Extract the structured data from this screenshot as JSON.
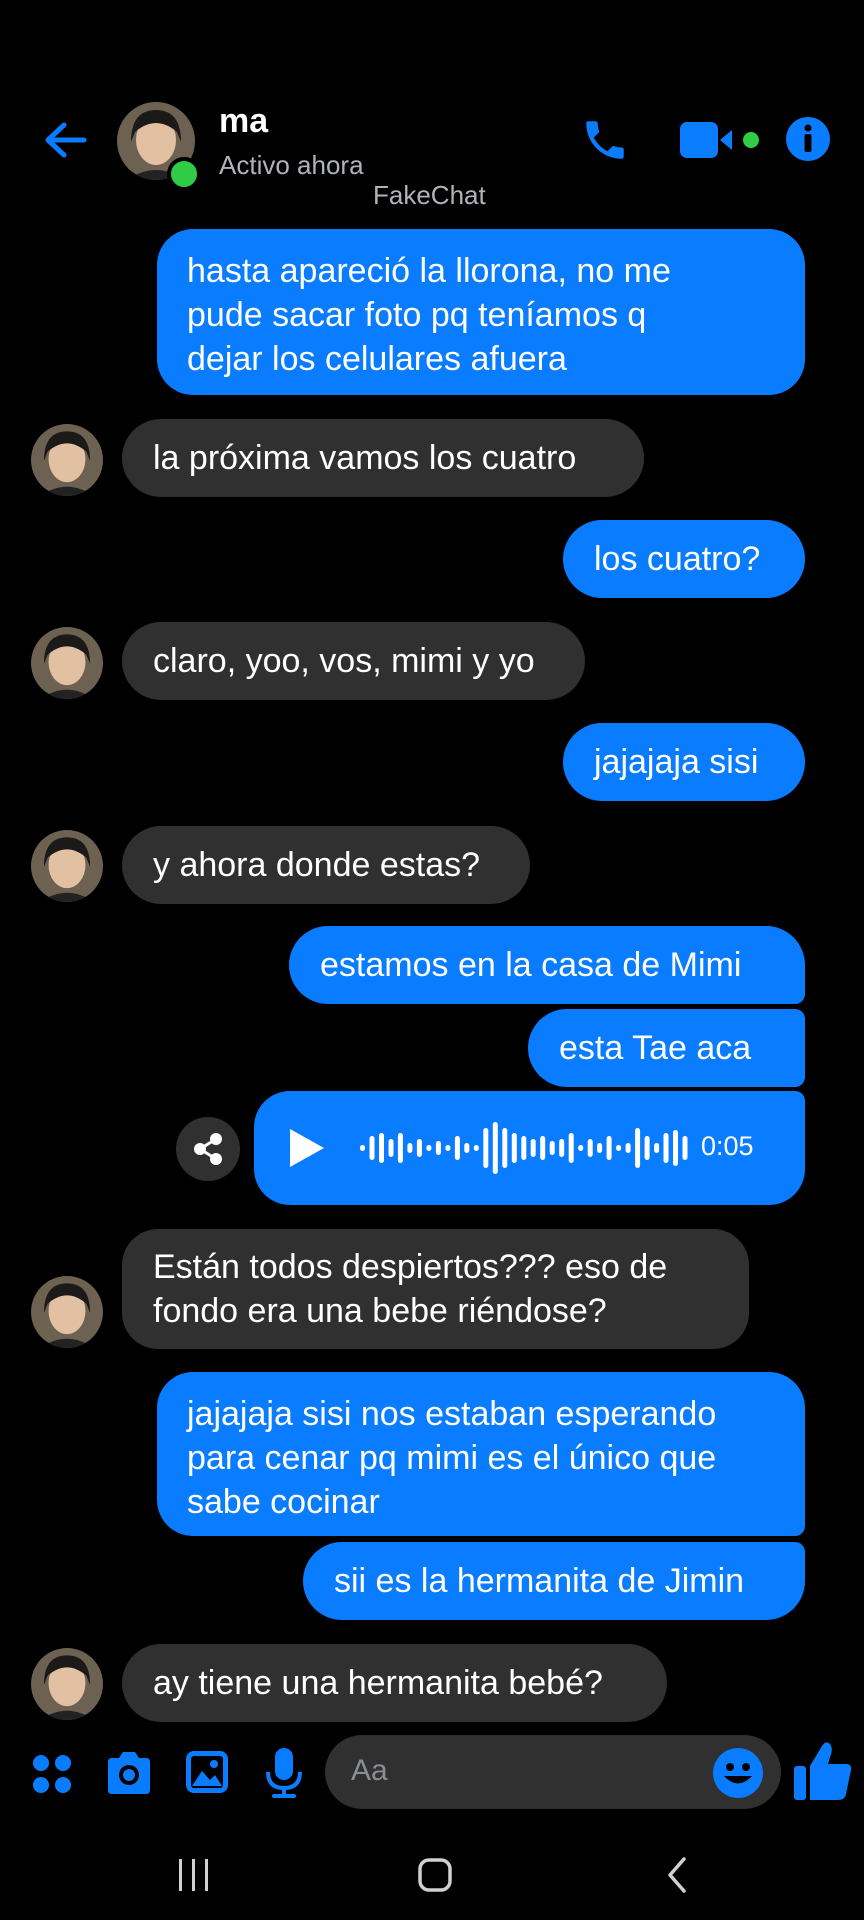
{
  "header": {
    "contact_name": "ma",
    "status": "Activo ahora",
    "watermark": "FakeChat"
  },
  "messages": [
    {
      "side": "out",
      "text": "hasta apareció la llorona, no me\npude sacar foto pq teníamos q\ndejar los celulares afuera"
    },
    {
      "side": "in",
      "text": "la próxima vamos los cuatro"
    },
    {
      "side": "out",
      "text": "los cuatro?"
    },
    {
      "side": "in",
      "text": "claro, yoo, vos, mimi y yo"
    },
    {
      "side": "out",
      "text": "jajajaja sisi"
    },
    {
      "side": "in",
      "text": "y ahora donde estas?"
    },
    {
      "side": "out",
      "text": "estamos en la casa de Mimi"
    },
    {
      "side": "out",
      "text": "esta Tae aca"
    },
    {
      "side": "out",
      "type": "voice",
      "duration": "0:05"
    },
    {
      "side": "in",
      "text": "Están todos despiertos??? eso de\nfondo era una bebe riéndose?"
    },
    {
      "side": "out",
      "text": "jajajaja sisi nos estaban esperando\npara cenar pq mimi es el único que\nsabe cocinar"
    },
    {
      "side": "out",
      "text": "sii es la hermanita de Jimin"
    },
    {
      "side": "in",
      "text": "ay tiene una hermanita bebé?"
    }
  ],
  "composer": {
    "placeholder": "Aa"
  },
  "icons": {
    "back": "back-arrow-icon",
    "call": "phone-icon",
    "video": "video-camera-icon",
    "info": "info-icon",
    "share": "share-icon",
    "play": "play-icon",
    "apps": "apps-grid-icon",
    "camera": "camera-icon",
    "gallery": "image-icon",
    "mic": "microphone-icon",
    "emoji": "emoji-icon",
    "like": "thumbs-up-icon",
    "nav_recent": "recent-apps-icon",
    "nav_home": "home-icon",
    "nav_back": "nav-back-icon"
  },
  "colors": {
    "accent": "#0a7cff",
    "incoming_bubble": "#303030",
    "online": "#31cc46",
    "background": "#000000"
  }
}
